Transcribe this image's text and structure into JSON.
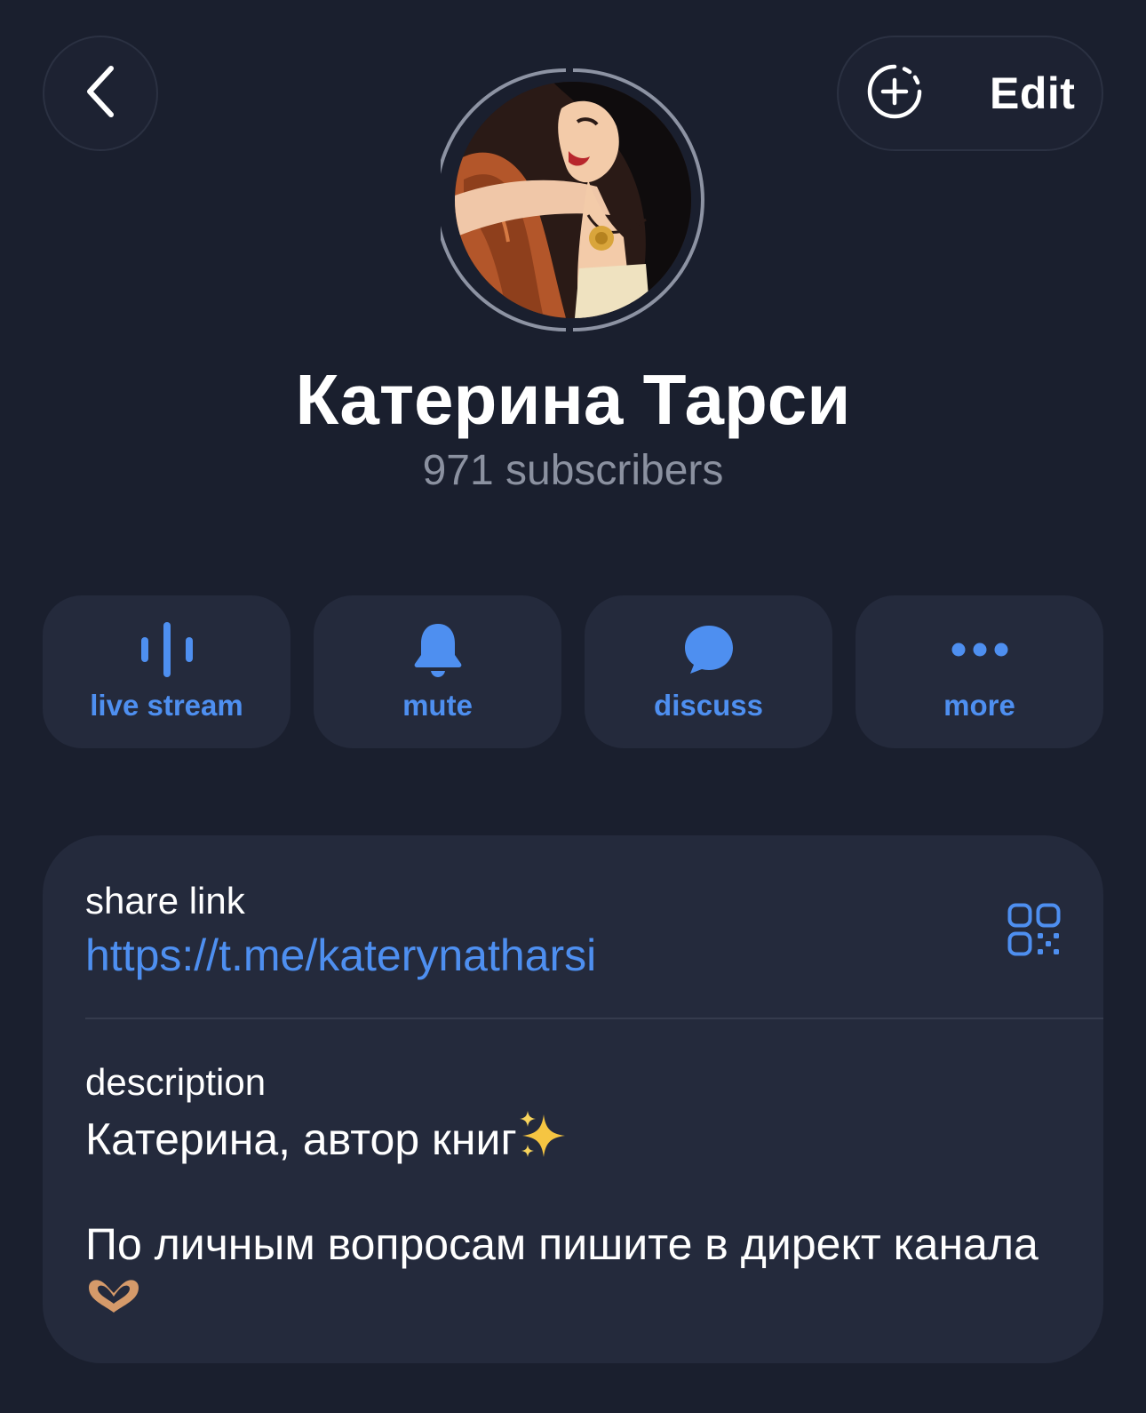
{
  "header": {
    "back_icon": "chevron-left-icon",
    "story_add_icon": "add-story-icon",
    "edit_label": "Edit"
  },
  "profile": {
    "name": "Катерина Тарси",
    "subscribers": "971 subscribers"
  },
  "actions": [
    {
      "label": "live stream",
      "icon": "voice-wave-icon"
    },
    {
      "label": "mute",
      "icon": "bell-icon"
    },
    {
      "label": "discuss",
      "icon": "chat-bubble-icon"
    },
    {
      "label": "more",
      "icon": "ellipsis-icon"
    }
  ],
  "info": {
    "share_title": "share link",
    "share_url": "https://t.me/katerynatharsi",
    "qr_icon": "qr-code-icon",
    "description_title": "description",
    "description_line1": "Катерина, автор книг",
    "description_line1_emoji": "sparkles-emoji",
    "description_line2": "По личным вопросам пишите в директ канала",
    "description_line2_emoji": "heart-hands-emoji"
  },
  "colors": {
    "background": "#1a1f2e",
    "card": "#242a3c",
    "accent": "#4e8ff0",
    "muted_text": "#8b91a0"
  }
}
